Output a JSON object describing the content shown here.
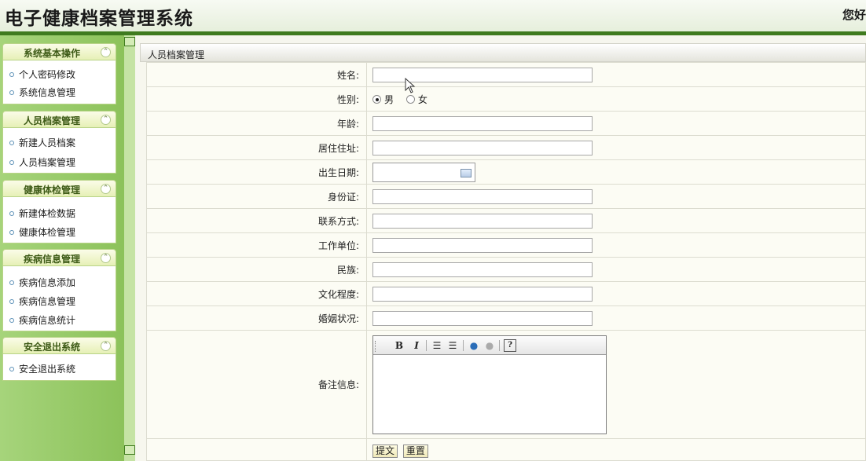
{
  "header": {
    "title": "电子健康档案管理系统",
    "welcome": "您好"
  },
  "sidebar": {
    "groups": [
      {
        "title": "系统基本操作",
        "items": [
          "个人密码修改",
          "系统信息管理"
        ]
      },
      {
        "title": "人员档案管理",
        "items": [
          "新建人员档案",
          "人员档案管理"
        ]
      },
      {
        "title": "健康体检管理",
        "items": [
          "新建体检数据",
          "健康体检管理"
        ]
      },
      {
        "title": "疾病信息管理",
        "items": [
          "疾病信息添加",
          "疾病信息管理",
          "疾病信息统计"
        ]
      },
      {
        "title": "安全退出系统",
        "items": [
          "安全退出系统"
        ]
      }
    ]
  },
  "panel": {
    "title": "人员档案管理"
  },
  "form": {
    "name_label": "姓名:",
    "gender_label": "性别:",
    "gender_options": [
      "男",
      "女"
    ],
    "gender_selected": "男",
    "age_label": "年龄:",
    "address_label": "居住住址:",
    "birth_label": "出生日期:",
    "idcard_label": "身份证:",
    "contact_label": "联系方式:",
    "work_label": "工作单位:",
    "ethnic_label": "民族:",
    "education_label": "文化程度:",
    "marital_label": "婚姻状况:",
    "remark_label": "备注信息:",
    "submit_label": "提文",
    "reset_label": "重置"
  },
  "editor_toolbar": [
    "B",
    "I",
    "ordered-list-icon",
    "unordered-list-icon",
    "link-icon",
    "unlink-icon",
    "help-icon"
  ]
}
